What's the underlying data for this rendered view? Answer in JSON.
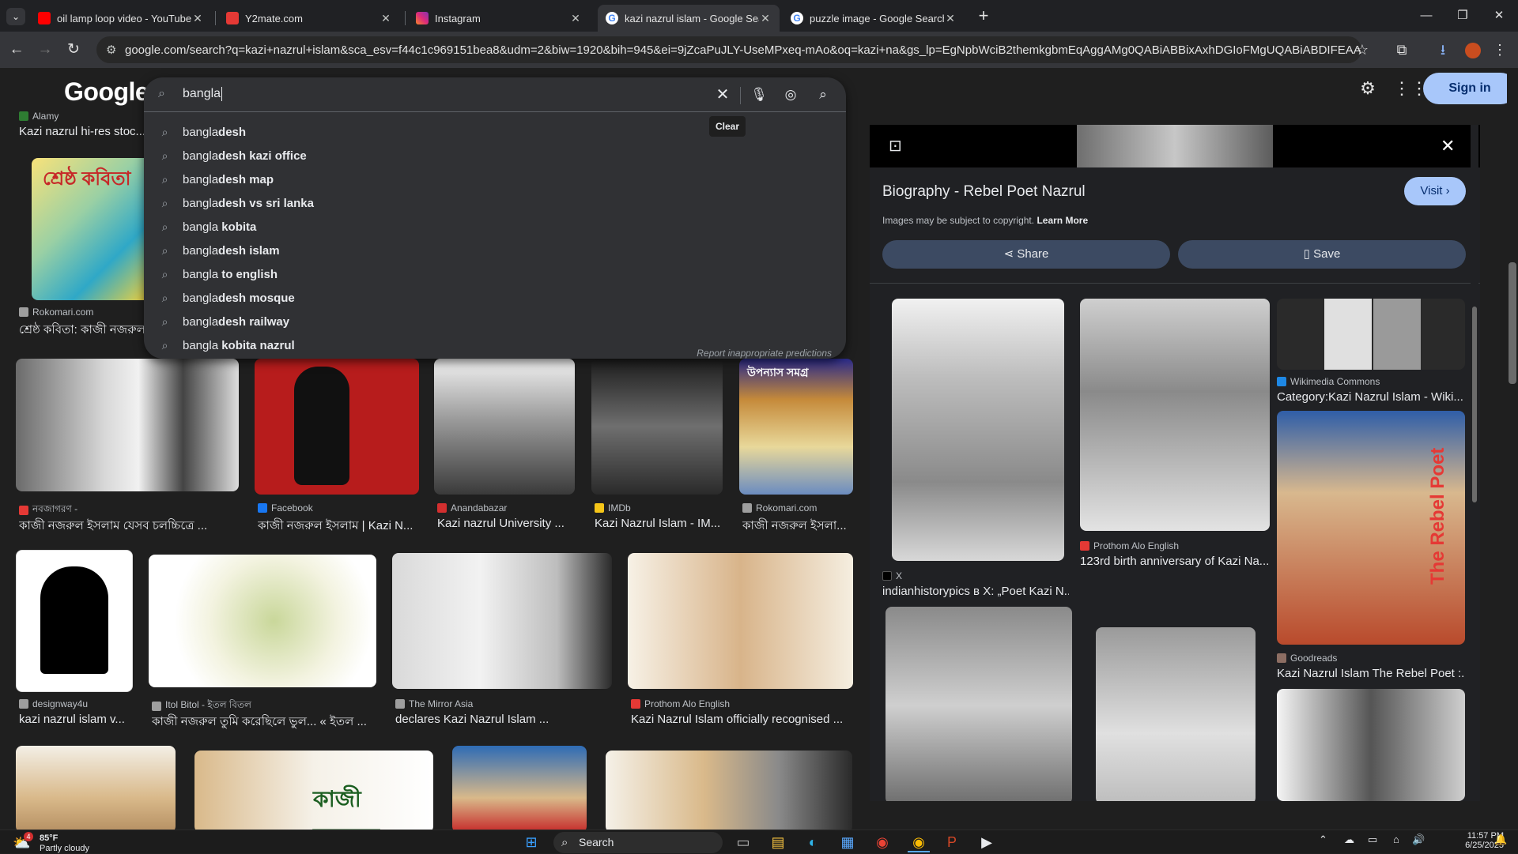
{
  "tabs": [
    {
      "title": "oil lamp loop video - YouTube",
      "favicon_color": "#ff0000"
    },
    {
      "title": "Y2mate.com",
      "favicon_color": "#e53935"
    },
    {
      "title": "Instagram",
      "favicon_color": "#d6249f"
    },
    {
      "title": "kazi nazrul islam - Google Search",
      "favicon_color": "#4285f4",
      "active": true
    },
    {
      "title": "puzzle image - Google Search",
      "favicon_color": "#4285f4"
    }
  ],
  "new_tab_label": "+",
  "address_bar": {
    "url": "google.com/search?q=kazi+nazrul+islam&sca_esv=f44c1c969151bea8&udm=2&biw=1920&bih=945&ei=9jZcaPuJLY-UseMPxeq-mAo&oq=kazi+na&gs_lp=EgNpbWciB2themkgbmEqAggAMg0QABiABBixAxhDGIoFMgUQABiABDIFEAAYgAQyBRAAG..."
  },
  "google": {
    "logo": "Google",
    "sign_in": "Sign in",
    "query": "bangla",
    "clear_tooltip": "Clear",
    "suggestions": [
      {
        "prefix": "bangla",
        "rest": "desh"
      },
      {
        "prefix": "bangla",
        "rest": "desh kazi office"
      },
      {
        "prefix": "bangla",
        "rest": "desh map"
      },
      {
        "prefix": "bangla",
        "rest": "desh vs sri lanka"
      },
      {
        "prefix": "bangla",
        "rest": " kobita"
      },
      {
        "prefix": "bangla",
        "rest": "desh islam"
      },
      {
        "prefix": "bangla",
        "rest": " to english"
      },
      {
        "prefix": "bangla",
        "rest": "desh mosque"
      },
      {
        "prefix": "bangla",
        "rest": "desh railway"
      },
      {
        "prefix": "bangla",
        "rest": " kobita nazrul"
      }
    ],
    "report_link": "Report inappropriate predictions"
  },
  "results": {
    "top_strip": {
      "source": "Alamy",
      "caption": "Kazi nazrul hi-res stoc..."
    },
    "book_tile_text": "শ্রেষ্ঠ কবিতা",
    "row1": {
      "source": "Rokomari.com",
      "caption": "শ্রেষ্ঠ কবিতা: কাজী নজরুল"
    },
    "row2": [
      {
        "source": "নবজাগরণ -",
        "caption": "কাজী নজরুল ইসলাম যেসব চলচ্চিত্রে ...",
        "color": "#e53935"
      },
      {
        "source": "Facebook",
        "caption": "কাজী নজরুল ইসলাম | Kazi N...",
        "color": "#1877f2"
      },
      {
        "source": "Anandabazar",
        "caption": "Kazi nazrul University ...",
        "color": "#d32f2f"
      },
      {
        "source": "IMDb",
        "caption": "Kazi Nazrul Islam - IM...",
        "color": "#f5c518"
      },
      {
        "source": "Rokomari.com",
        "caption": "কাজী নজরুল ইসলা...",
        "color": "#9e9e9e"
      }
    ],
    "uponnas_text": "উপন্যাস সমগ্র",
    "row3": [
      {
        "source": "designway4u",
        "caption": "kazi nazrul islam v...",
        "color": "#9e9e9e"
      },
      {
        "source": "Itol Bitol - ইতল বিতল",
        "caption": "কাজী নজরুল তুমি করেছিলে ভুল... « ইতল ...",
        "color": "#9e9e9e"
      },
      {
        "source": "The Mirror Asia",
        "caption": "declares Kazi Nazrul Islam ...",
        "color": "#9e9e9e"
      },
      {
        "source": "Prothom Alo English",
        "caption": "Kazi Nazrul Islam officially recognised ...",
        "color": "#e53935"
      }
    ],
    "row4_banner_text": "কাজী নজরুল"
  },
  "side_panel": {
    "title": "Biography - Rebel Poet Nazrul",
    "note": "Images may be subject to copyright.",
    "learn_more": "Learn More",
    "visit": "Visit",
    "share": "Share",
    "save": "Save",
    "related": [
      {
        "source": "X",
        "caption": "indianhistorypics в X: „Poet Kazi N..."
      },
      {
        "source": "Prothom Alo English",
        "caption": "123rd birth anniversary of Kazi Na..."
      },
      {
        "source": "Wikimedia Commons",
        "caption": "Category:Kazi Nazrul Islam - Wiki..."
      },
      {
        "source": "Goodreads",
        "caption": "Kazi Nazrul Islam The Rebel Poet :..."
      }
    ],
    "rebel_poet_text": "The Rebel Poet"
  },
  "taskbar": {
    "weather_temp": "85°F",
    "weather_desc": "Partly cloudy",
    "weather_badge": "4",
    "search_label": "Search",
    "time": "11:57 PM",
    "date": "6/25/2025"
  }
}
